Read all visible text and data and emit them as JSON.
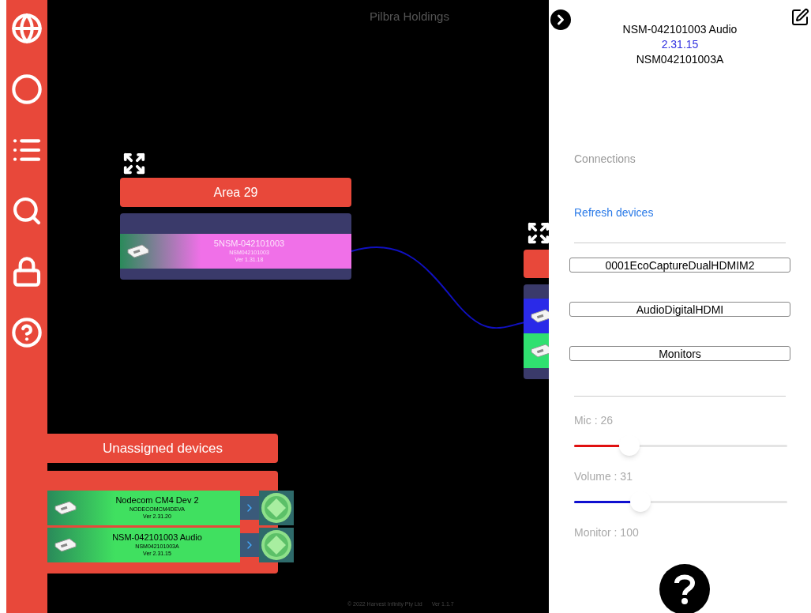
{
  "sidebar": {
    "items": [
      {
        "kind": "globe"
      },
      {
        "kind": "circle"
      },
      {
        "kind": "list"
      },
      {
        "kind": "search"
      },
      {
        "kind": "lock"
      },
      {
        "kind": "help"
      }
    ]
  },
  "canvas": {
    "title": "Pilbra Holdings",
    "groups": [
      {
        "title": "Area 29",
        "devices": [
          {
            "name": "5NSM-042101003",
            "serial": "NSM042101003",
            "version": "Ver 1.31.18",
            "color": "#f070e8"
          }
        ]
      },
      {
        "devices": [
          {
            "color": "#2a2ae8"
          },
          {
            "color": "#30e070"
          }
        ]
      }
    ],
    "unassigned": {
      "title": "Unassigned devices",
      "devices": [
        {
          "name": "Nodecom CM4 Dev 2",
          "serial": "NODECOMCM4DEVA",
          "version": "Ver 2.31.20",
          "color": "#40e060"
        },
        {
          "name": "NSM-042101003 Audio",
          "serial": "NSM042101003A",
          "version": "Ver 2.31.15",
          "color": "#40e060"
        }
      ]
    },
    "footer": {
      "copyright": "© 2022 Harvest Infinity Pty Ltd",
      "version": "Ver 1.1.7"
    }
  },
  "panel": {
    "name": "NSM-042101003 Audio",
    "version": "2.31.15",
    "serial": "NSM042101003A",
    "connections_label": "Connections",
    "refresh_link": "Refresh devices",
    "buttons": [
      "0001EcoCaptureDualHDMIM2",
      "AudioDigitalHDMI",
      "Monitors"
    ],
    "sliders": [
      {
        "label": "Mic : 26",
        "level": 0.26,
        "color": "#e01010"
      },
      {
        "label": "Volume : 31",
        "level": 0.31,
        "color": "#1010d0"
      },
      {
        "label": "Monitor : 100"
      }
    ]
  }
}
